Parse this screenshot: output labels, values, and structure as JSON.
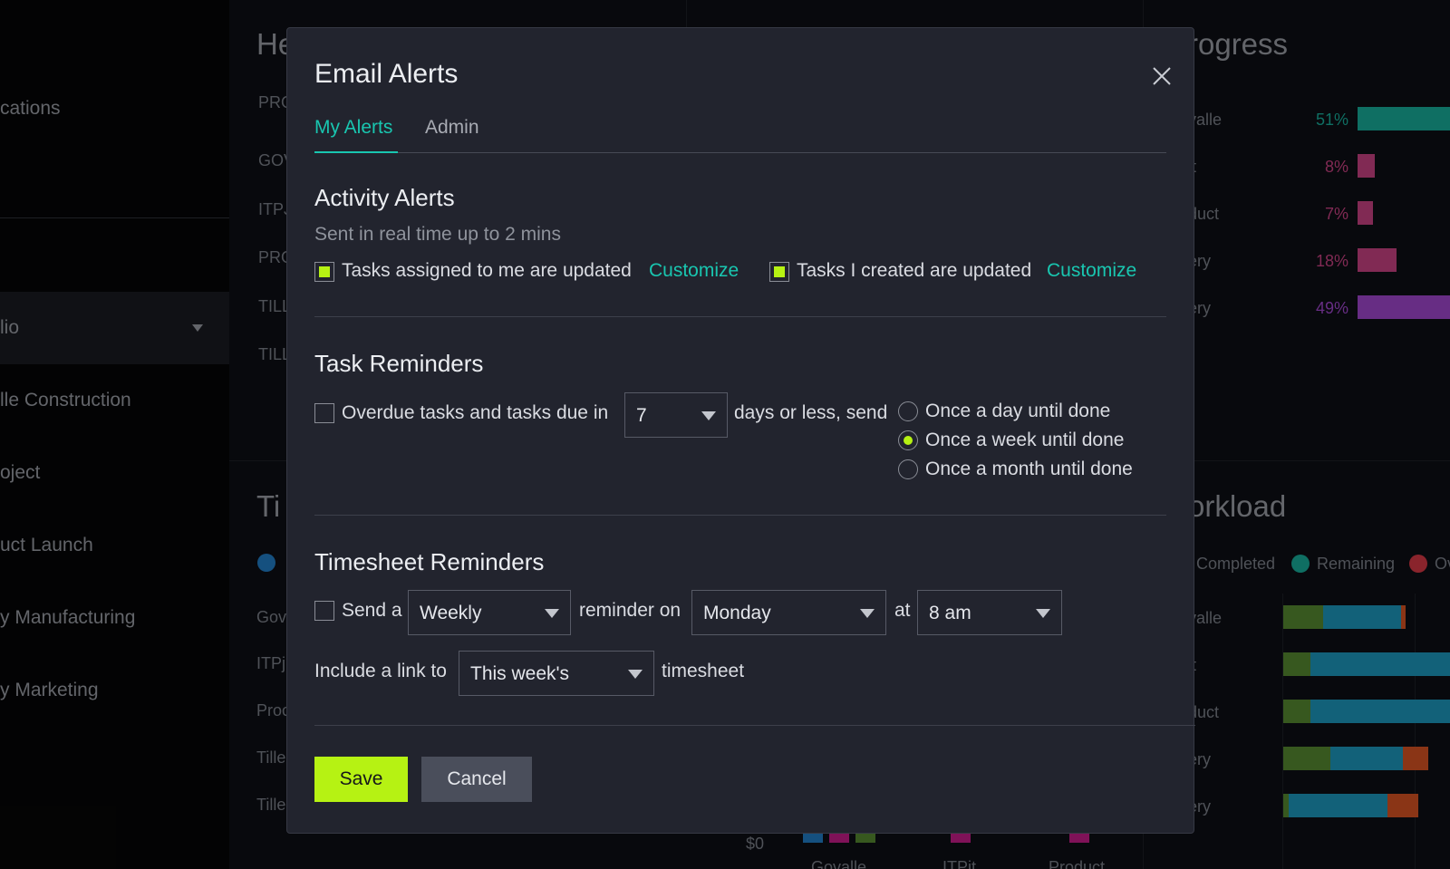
{
  "background": {
    "sidebar": {
      "items": [
        "cations",
        "lio",
        "lle Construction",
        "oject",
        "uct Launch",
        "y Manufacturing",
        "y Marketing"
      ]
    },
    "health": {
      "heading": "He",
      "col_header": "PRO",
      "rows": [
        "GOV",
        "ITPJ",
        "PRO",
        "TILL",
        "TILL"
      ]
    },
    "time": {
      "heading": "Ti",
      "rows": [
        "Gov",
        "ITPj",
        "Proc",
        "Tille",
        "Tille"
      ],
      "axis_label": "$0",
      "x_labels": [
        "Govalle",
        "ITPjt",
        "Product"
      ]
    },
    "progress": {
      "heading": "rogress",
      "rows": [
        {
          "label": "valle",
          "pct": "51%",
          "value": 51,
          "color": "#159a8a"
        },
        {
          "label": "jt",
          "pct": "8%",
          "value": 8,
          "color": "#b33b75"
        },
        {
          "label": "duct",
          "pct": "7%",
          "value": 7,
          "color": "#b33b75"
        },
        {
          "label": "ery",
          "pct": "18%",
          "value": 18,
          "color": "#b33b75"
        },
        {
          "label": "ery",
          "pct": "49%",
          "value": 49,
          "color": "#8f3fb8"
        }
      ]
    },
    "workload": {
      "heading": "orkload",
      "legend": [
        {
          "label": "Completed",
          "color": "#4d7a2c"
        },
        {
          "label": "Remaining",
          "color": "#159a8a"
        },
        {
          "label": "Ov",
          "color": "#c0323d"
        }
      ],
      "rows": [
        "valle",
        "jt",
        "duct",
        "ery",
        "ery"
      ]
    }
  },
  "modal": {
    "title": "Email Alerts",
    "tabs": [
      "My Alerts",
      "Admin"
    ],
    "activity": {
      "title": "Activity Alerts",
      "subtitle": "Sent in real time up to 2 mins",
      "assigned_label": "Tasks assigned to me are updated",
      "created_label": "Tasks I created are updated",
      "customize_label": "Customize"
    },
    "task_reminders": {
      "title": "Task Reminders",
      "overdue_label": "Overdue tasks and tasks due in",
      "days_value": "7",
      "days_suffix": "days or less, send",
      "options": [
        "Once a day until done",
        "Once a week until done",
        "Once a month until done"
      ]
    },
    "timesheet": {
      "title": "Timesheet Reminders",
      "send_label": "Send a",
      "frequency_value": "Weekly",
      "reminder_on_label": "reminder on",
      "day_value": "Monday",
      "at_label": "at",
      "time_value": "8 am",
      "include_label": "Include a link to",
      "link_value": "This week's",
      "link_suffix": "timesheet"
    },
    "buttons": {
      "save": "Save",
      "cancel": "Cancel"
    }
  }
}
